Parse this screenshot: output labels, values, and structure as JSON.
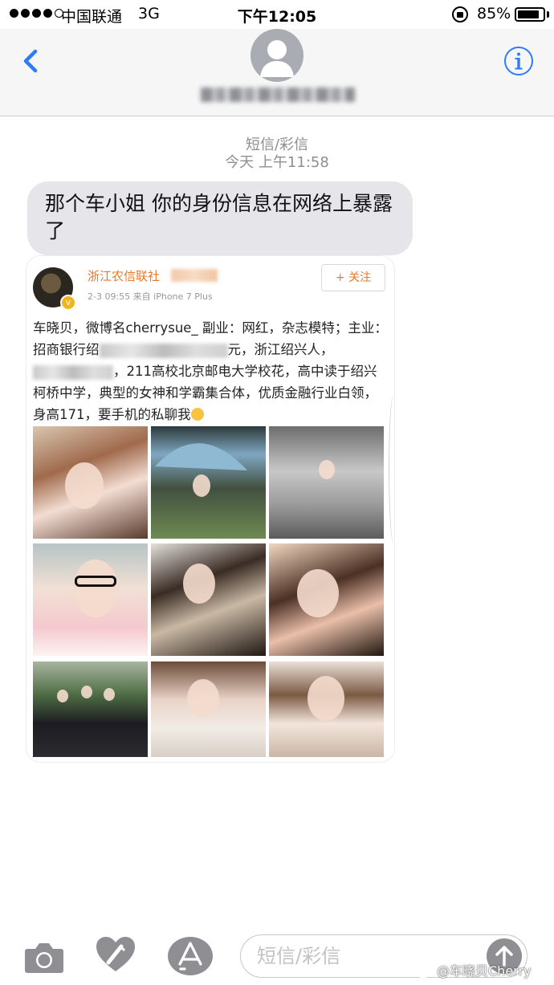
{
  "status_bar": {
    "carrier": "中国联通",
    "network": "3G",
    "time": "下午12:05",
    "battery_percent": "85%",
    "battery_level": 0.85,
    "signal_bars_filled": 4,
    "signal_bars_total": 5
  },
  "header": {
    "back_icon": "chevron-left-icon",
    "avatar_icon": "person-silhouette-icon",
    "info_icon": "info-circle-icon",
    "accent_color": "#2f7cf6"
  },
  "conversation": {
    "service_label": "短信/彩信",
    "timestamp": "今天 上午11:58",
    "message_text": "那个车小姐 你的身份信息在网络上暴露了"
  },
  "attachment": {
    "poster_name": "浙江农信联社",
    "post_time": "2-3 09:55",
    "post_source": "来自 iPhone 7 Plus",
    "follow_label": "+ 关注",
    "text_part1": "车晓贝，微博名cherrysue_ 副业：网红，杂志模特；主业：招商银行绍",
    "text_part2": "元，浙江绍兴人，",
    "text_part3": "，211高校北京邮电大学校花，高中读于绍兴柯桥中学，典型的女神和学霸集合体，优质金融行业白领，身高171，要手机的私聊我",
    "name_color": "#e8782a",
    "photo_count": 9
  },
  "input_bar": {
    "placeholder": "短信/彩信",
    "camera_icon": "camera-icon",
    "digital_touch_icon": "digital-touch-heart-icon",
    "appstore_icon": "app-store-icon",
    "send_icon": "arrow-up-icon"
  },
  "watermark": {
    "text": "@车晓贝Cherry"
  }
}
